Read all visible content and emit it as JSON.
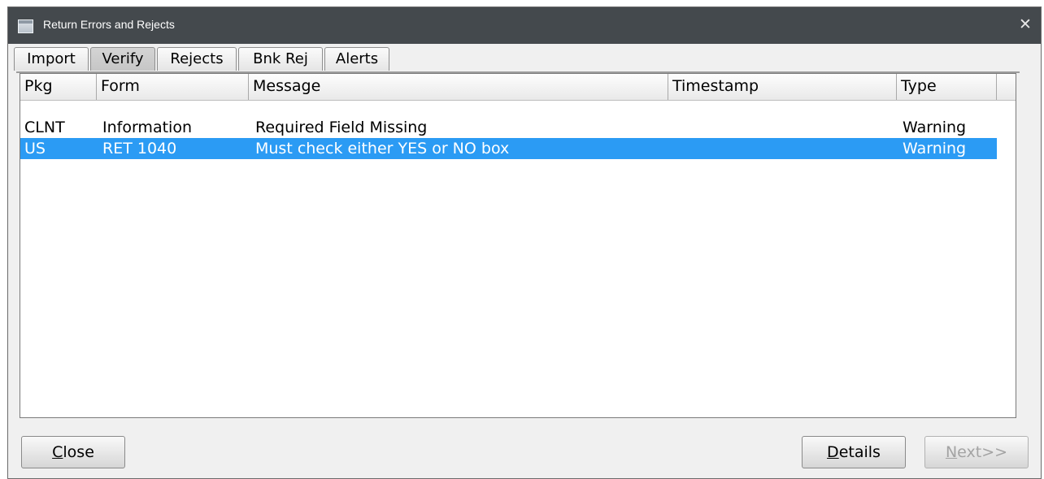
{
  "window": {
    "title": "Return Errors and Rejects",
    "close_glyph": "✕"
  },
  "tabs": [
    {
      "label": "Import",
      "active": false
    },
    {
      "label": "Verify",
      "active": true
    },
    {
      "label": "Rejects",
      "active": false
    },
    {
      "label": "Bnk Rej",
      "active": false
    },
    {
      "label": "Alerts",
      "active": false
    }
  ],
  "table": {
    "columns": [
      "Pkg",
      "Form",
      "Message",
      "Timestamp",
      "Type"
    ],
    "rows": [
      {
        "pkg": "CLNT",
        "form": "Information",
        "message": "Required Field Missing",
        "timestamp": "",
        "type": "Warning",
        "selected": false
      },
      {
        "pkg": "US",
        "form": "RET 1040",
        "message": "Must check either YES or NO box",
        "timestamp": "",
        "type": "Warning",
        "selected": true
      }
    ]
  },
  "buttons": {
    "close": {
      "mnemonic": "C",
      "rest": "lose"
    },
    "details": {
      "mnemonic": "D",
      "rest": "etails"
    },
    "next": {
      "mnemonic": "N",
      "rest": "ext>>",
      "enabled": false
    }
  },
  "colors": {
    "titlebar": "#44494d",
    "selection": "#2b9bf4"
  }
}
